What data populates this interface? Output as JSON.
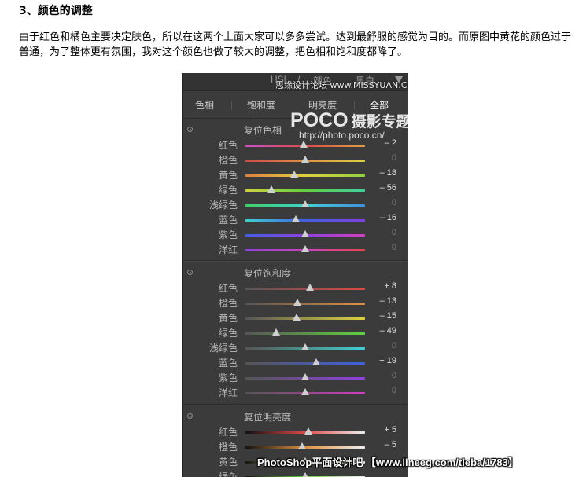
{
  "article": {
    "heading": "3、颜色的调整",
    "body": "由于红色和橘色主要决定肤色，所以在这两个上面大家可以多多尝试。达到最舒服的感觉为目的。而原图中黄花的颜色过于普通，为了整体更有氛围，我对这个颜色也做了较大的调整，把色相和饱和度都降了。"
  },
  "panel": {
    "header": {
      "hsl": "HSL",
      "sep": "/",
      "color": "颜色",
      "bw": "黑白"
    },
    "header_watermark": "思缘设计论坛 www.MISSYUAN.COM",
    "tabs": {
      "hue": "色相",
      "saturation": "饱和度",
      "luminance": "明亮度",
      "all": "全部"
    },
    "poco": {
      "logo": "POCO",
      "cn": "摄影专题",
      "url": "http://photo.poco.cn/"
    },
    "sections": [
      {
        "title": "复位色相",
        "rows": [
          {
            "label": "红色",
            "value": "– 2",
            "num": -2
          },
          {
            "label": "橙色",
            "value": "0",
            "num": 0
          },
          {
            "label": "黄色",
            "value": "– 18",
            "num": -18
          },
          {
            "label": "绿色",
            "value": "– 56",
            "num": -56
          },
          {
            "label": "浅绿色",
            "value": "0",
            "num": 0
          },
          {
            "label": "蓝色",
            "value": "– 16",
            "num": -16
          },
          {
            "label": "紫色",
            "value": "0",
            "num": 0
          },
          {
            "label": "洋红",
            "value": "0",
            "num": 0
          }
        ]
      },
      {
        "title": "复位饱和度",
        "rows": [
          {
            "label": "红色",
            "value": "+ 8",
            "num": 8
          },
          {
            "label": "橙色",
            "value": "– 13",
            "num": -13
          },
          {
            "label": "黄色",
            "value": "– 15",
            "num": -15
          },
          {
            "label": "绿色",
            "value": "– 49",
            "num": -49
          },
          {
            "label": "浅绿色",
            "value": "0",
            "num": 0
          },
          {
            "label": "蓝色",
            "value": "+ 19",
            "num": 19
          },
          {
            "label": "紫色",
            "value": "0",
            "num": 0
          },
          {
            "label": "洋红",
            "value": "0",
            "num": 0
          }
        ]
      },
      {
        "title": "复位明亮度",
        "rows": [
          {
            "label": "红色",
            "value": "+ 5",
            "num": 5
          },
          {
            "label": "橙色",
            "value": "– 5",
            "num": -5
          },
          {
            "label": "黄色",
            "value": "",
            "num": 0
          },
          {
            "label": "绿色",
            "value": "",
            "num": 0
          }
        ]
      }
    ]
  },
  "footer_watermark": "PhotoShop平面设计吧 【www.lineeg.com/tieba/1783】",
  "colors": {
    "panel_bg": "#3b3b3b",
    "thumb": "#cfcfcf",
    "text": "#b5b5b5"
  }
}
